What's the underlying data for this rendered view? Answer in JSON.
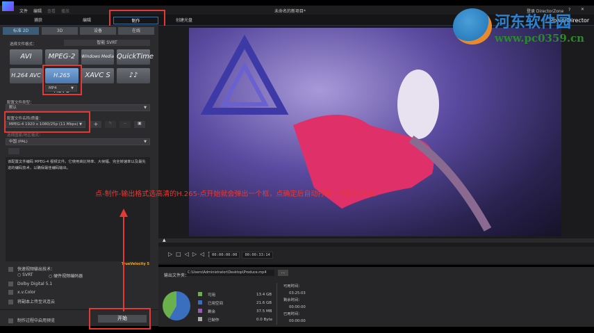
{
  "menu": [
    "文件",
    "编辑",
    "查看",
    "播放"
  ],
  "window_title": "未命名的新项目*",
  "account": "登录 DirectorZone",
  "help": "?",
  "app_name": "PowerDirector",
  "main_tabs": [
    "捕获",
    "编辑",
    "制作",
    "创建光盘"
  ],
  "sub_tabs": [
    "标准 2D",
    "3D",
    "设备",
    "在线"
  ],
  "select_format_label": "选择文件格式：",
  "svrt_label": "智能 SVRT",
  "formats": [
    "AVI",
    "MPEG-2",
    "Windows Media",
    "QuickTime",
    "H.264 AVC",
    "H.265 HEVC",
    "XAVC S",
    "♪♪"
  ],
  "container": "MP4",
  "profile_type_label": "配置文件类型：",
  "profile_type": "默认",
  "profile_name_label": "配置文件名称/质量：",
  "profile_name": "MPEG-4 1920 x 1080/25p (11 Mbps)",
  "profile_buttons": [
    "+",
    "✎",
    "−",
    "▣"
  ],
  "region_label": "选择国家/地区格式：",
  "region": "中国 (PAL)",
  "description": "该配置文件编码 MPEG-4 视频文件。它使用高比特率、大帧幅、完全转速率以及最先进的编码技术，以确保最佳编码输出。",
  "fast_render_label": "快速视频输出技术：",
  "radio_options": [
    "SVRT",
    "硬件视频编码器"
  ],
  "velocity": "TrueVelocity 5",
  "options": [
    "Dolby Digital 5.1",
    "x.v.Color",
    "将副本上传至讯连云"
  ],
  "preview_label": "制作过程中启用预览",
  "start_button": "开始",
  "annotation": "点-制作-输出格式选高清的H.265-点开始就会弹出一个框，点确定后自动打开一个新对话框。",
  "watermark": {
    "title": "河东软件园",
    "url": "www.pc0359.cn"
  },
  "timecodes": [
    "00:00:00:00",
    "00:00:33:14"
  ],
  "output_folder_label": "输出文件夹：",
  "output_path": "C:\\Users\\Administrator\\Desktop\\Produce.mp4",
  "browse": "...",
  "disk": [
    {
      "label": "可用",
      "value": "13.4 GB",
      "color": "#6ab04c"
    },
    {
      "label": "已用空间",
      "value": "21.6 GB",
      "color": "#3a6fc0"
    },
    {
      "label": "剩余",
      "value": "37.5 MB",
      "color": "#9b59b6"
    },
    {
      "label": "已制作",
      "value": "0.0 Byte",
      "color": "#aaaaaa"
    }
  ],
  "times": [
    {
      "label": "可用时间：",
      "value": "03:25:03"
    },
    {
      "label": "剩余时间：",
      "value": "00:00:00"
    },
    {
      "label": "已用时间：",
      "value": "00:00:00"
    }
  ]
}
